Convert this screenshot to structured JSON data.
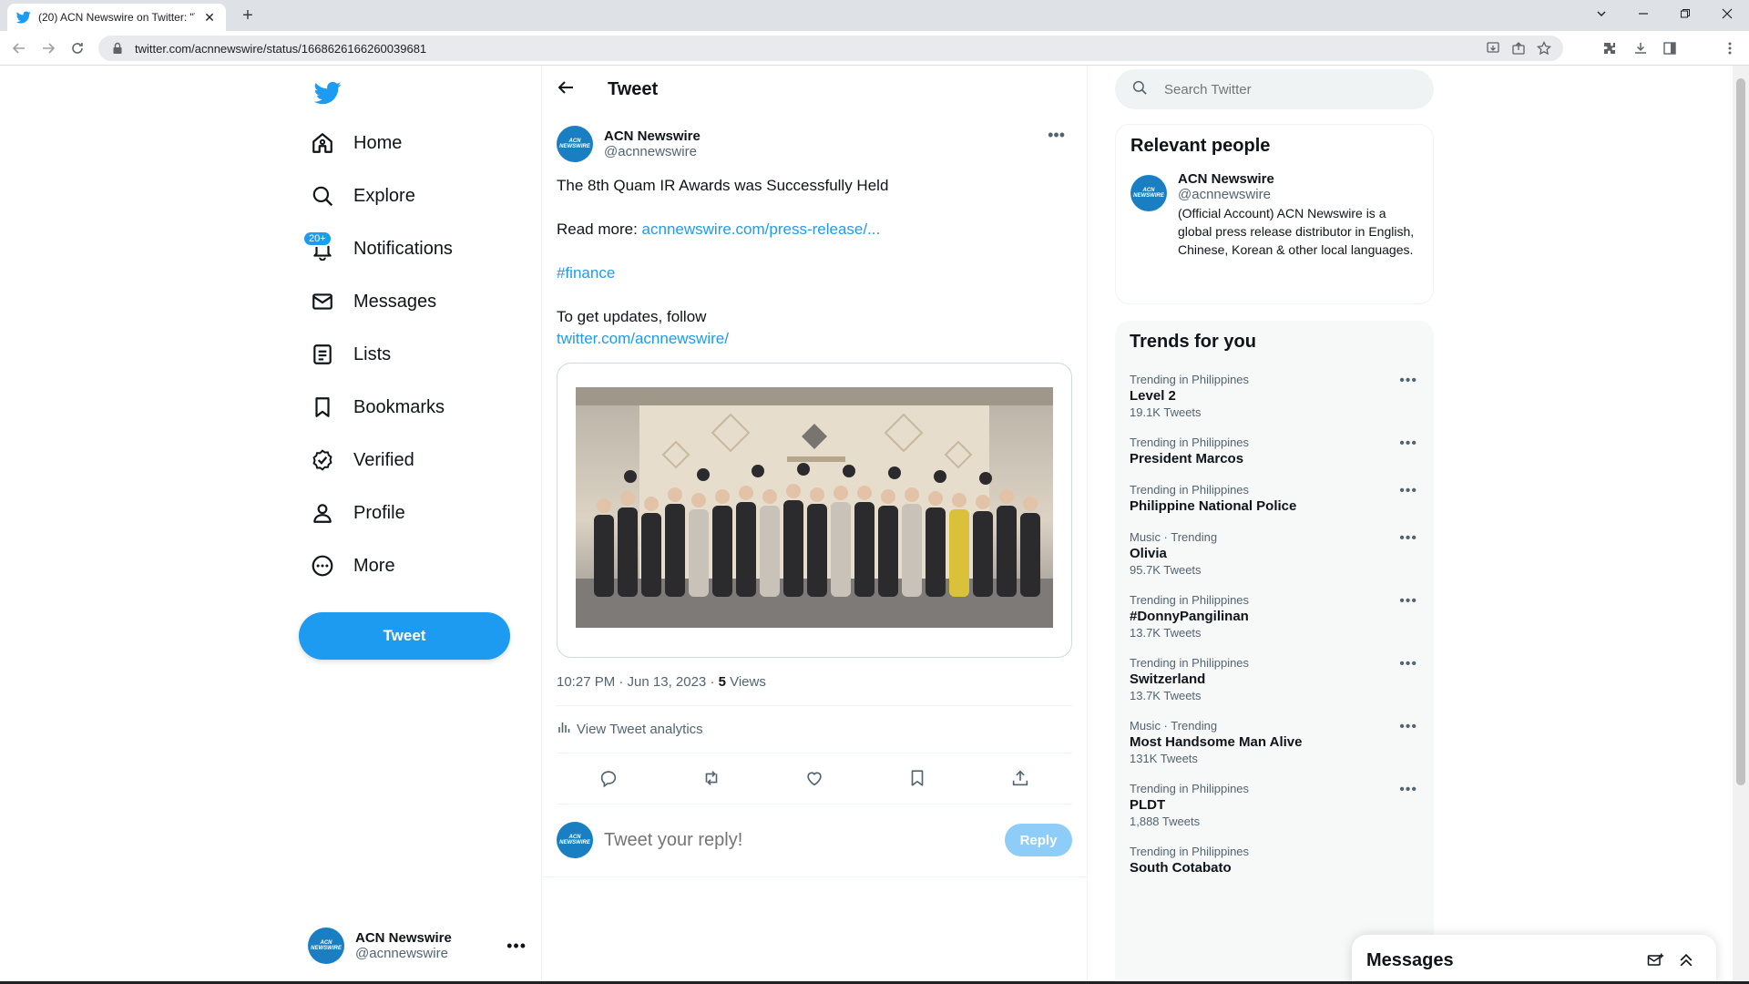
{
  "browser": {
    "tab_title": "(20) ACN Newswire on Twitter: \"T",
    "tab_close": "✕",
    "new_tab": "+",
    "url": "twitter.com/acnnewswire/status/1668626166260039681"
  },
  "nav": {
    "items": [
      {
        "label": "Home",
        "icon": "home-icon"
      },
      {
        "label": "Explore",
        "icon": "search-icon"
      },
      {
        "label": "Notifications",
        "icon": "bell-icon",
        "badge": "20+"
      },
      {
        "label": "Messages",
        "icon": "envelope-icon"
      },
      {
        "label": "Lists",
        "icon": "list-icon"
      },
      {
        "label": "Bookmarks",
        "icon": "bookmark-icon"
      },
      {
        "label": "Verified",
        "icon": "verified-icon"
      },
      {
        "label": "Profile",
        "icon": "person-icon"
      },
      {
        "label": "More",
        "icon": "more-circle-icon"
      }
    ],
    "tweet_button": "Tweet",
    "account": {
      "name": "ACN Newswire",
      "handle": "@acnnewswire",
      "avatar_text": "ACN NEWSWIRE"
    }
  },
  "tweet": {
    "header_title": "Tweet",
    "author": {
      "name": "ACN Newswire",
      "handle": "@acnnewswire",
      "avatar_text": "ACN NEWSWIRE"
    },
    "text_line1": "The 8th Quam IR Awards was Successfully Held",
    "read_more_prefix": "Read more: ",
    "read_more_link": "acnnewswire.com/press-release/...",
    "hashtag": "#finance",
    "follow_text": "To get updates, follow",
    "follow_link": "twitter.com/acnnewswire/",
    "timestamp": "10:27 PM · Jun 13, 2023 · ",
    "views_count": "5",
    "views_label": " Views",
    "analytics_label": "View Tweet analytics",
    "reply_placeholder": "Tweet your reply!",
    "reply_button": "Reply"
  },
  "right": {
    "search_placeholder": "Search Twitter",
    "relevant_title": "Relevant people",
    "relevant_person": {
      "name": "ACN Newswire",
      "handle": "@acnnewswire",
      "bio": "(Official Account) ACN Newswire is a global press release distributor in English, Chinese, Korean & other local languages.",
      "avatar_text": "ACN NEWSWIRE"
    },
    "trends_title": "Trends for you",
    "trends": [
      {
        "context": "Trending in Philippines",
        "name": "Level 2",
        "count": "19.1K Tweets"
      },
      {
        "context": "Trending in Philippines",
        "name": "President Marcos",
        "count": ""
      },
      {
        "context": "Trending in Philippines",
        "name": "Philippine National Police",
        "count": ""
      },
      {
        "context": "Music · Trending",
        "name": "Olivia",
        "count": "95.7K Tweets"
      },
      {
        "context": "Trending in Philippines",
        "name": "#DonnyPangilinan",
        "count": "13.7K Tweets"
      },
      {
        "context": "Trending in Philippines",
        "name": "Switzerland",
        "count": "13.7K Tweets"
      },
      {
        "context": "Music · Trending",
        "name": "Most Handsome Man Alive",
        "count": "131K Tweets"
      },
      {
        "context": "Trending in Philippines",
        "name": "PLDT",
        "count": "1,888 Tweets"
      },
      {
        "context": "Trending in Philippines",
        "name": "South Cotabato",
        "count": ""
      }
    ]
  },
  "drawer": {
    "title": "Messages"
  },
  "colors": {
    "accent": "#1d9bf0",
    "text": "#0f1419",
    "muted": "#536471"
  }
}
